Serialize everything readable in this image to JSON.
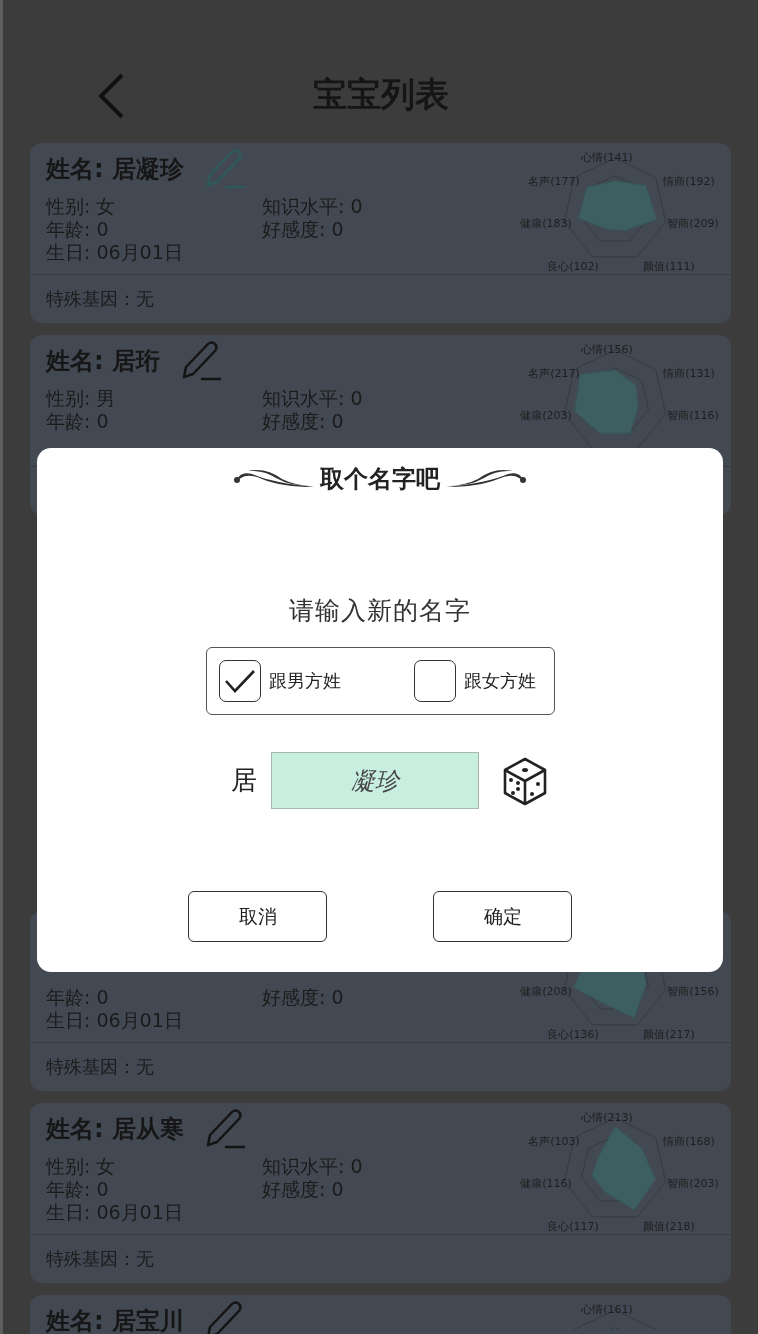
{
  "header": {
    "title": "宝宝列表"
  },
  "babies": [
    {
      "name": "姓名: 居凝珍",
      "editing": true,
      "fields": [
        "性别: 女",
        "知识水平: 0",
        "年龄: 0",
        "好感度: 0",
        "生日: 06月01日"
      ],
      "gene": "特殊基因：无",
      "stats": {
        "top": "心情(141)",
        "upper_left": "名声(177)",
        "upper_right": "情商(192)",
        "left": "健康(183)",
        "right": "智商(209)",
        "lower_left": "良心(102)",
        "lower_right": "颜值(111)"
      }
    },
    {
      "name": "姓名: 居珩",
      "editing": false,
      "fields": [
        "性别: 男",
        "知识水平: 0",
        "年龄: 0",
        "好感度: 0"
      ],
      "stats": {
        "top": "心情(156)",
        "upper_left": "名声(217)",
        "upper_right": "情商(131)",
        "left": "健康(203)",
        "right": "智商(116)"
      }
    },
    {
      "kind": "spacer"
    },
    {
      "fields": [
        "年龄: 0",
        "好感度: 0",
        "生日: 06月01日"
      ],
      "gene": "特殊基因：无",
      "stats": {
        "left": "健康(208)",
        "right": "智商(156)",
        "lower_left": "良心(136)",
        "lower_right": "颜值(217)"
      }
    },
    {
      "name": "姓名: 居从寒",
      "editing": false,
      "fields": [
        "性别: 女",
        "知识水平: 0",
        "年龄: 0",
        "好感度: 0",
        "生日: 06月01日"
      ],
      "gene": "特殊基因：无",
      "stats": {
        "top": "心情(213)",
        "upper_left": "名声(103)",
        "upper_right": "情商(168)",
        "left": "健康(116)",
        "right": "智商(203)",
        "lower_left": "良心(117)",
        "lower_right": "颜值(218)"
      }
    },
    {
      "name": "姓名: 居宝川",
      "editing": false,
      "stats": {
        "top": "心情(161)"
      }
    }
  ],
  "dialog": {
    "title": "取个名字吧",
    "prompt": "请输入新的名字",
    "options": [
      {
        "label": "跟男方姓",
        "checked": true
      },
      {
        "label": "跟女方姓",
        "checked": false
      }
    ],
    "surname": "居",
    "name_value": "凝珍",
    "buttons": [
      {
        "label": "取消"
      },
      {
        "label": "确定"
      }
    ]
  }
}
